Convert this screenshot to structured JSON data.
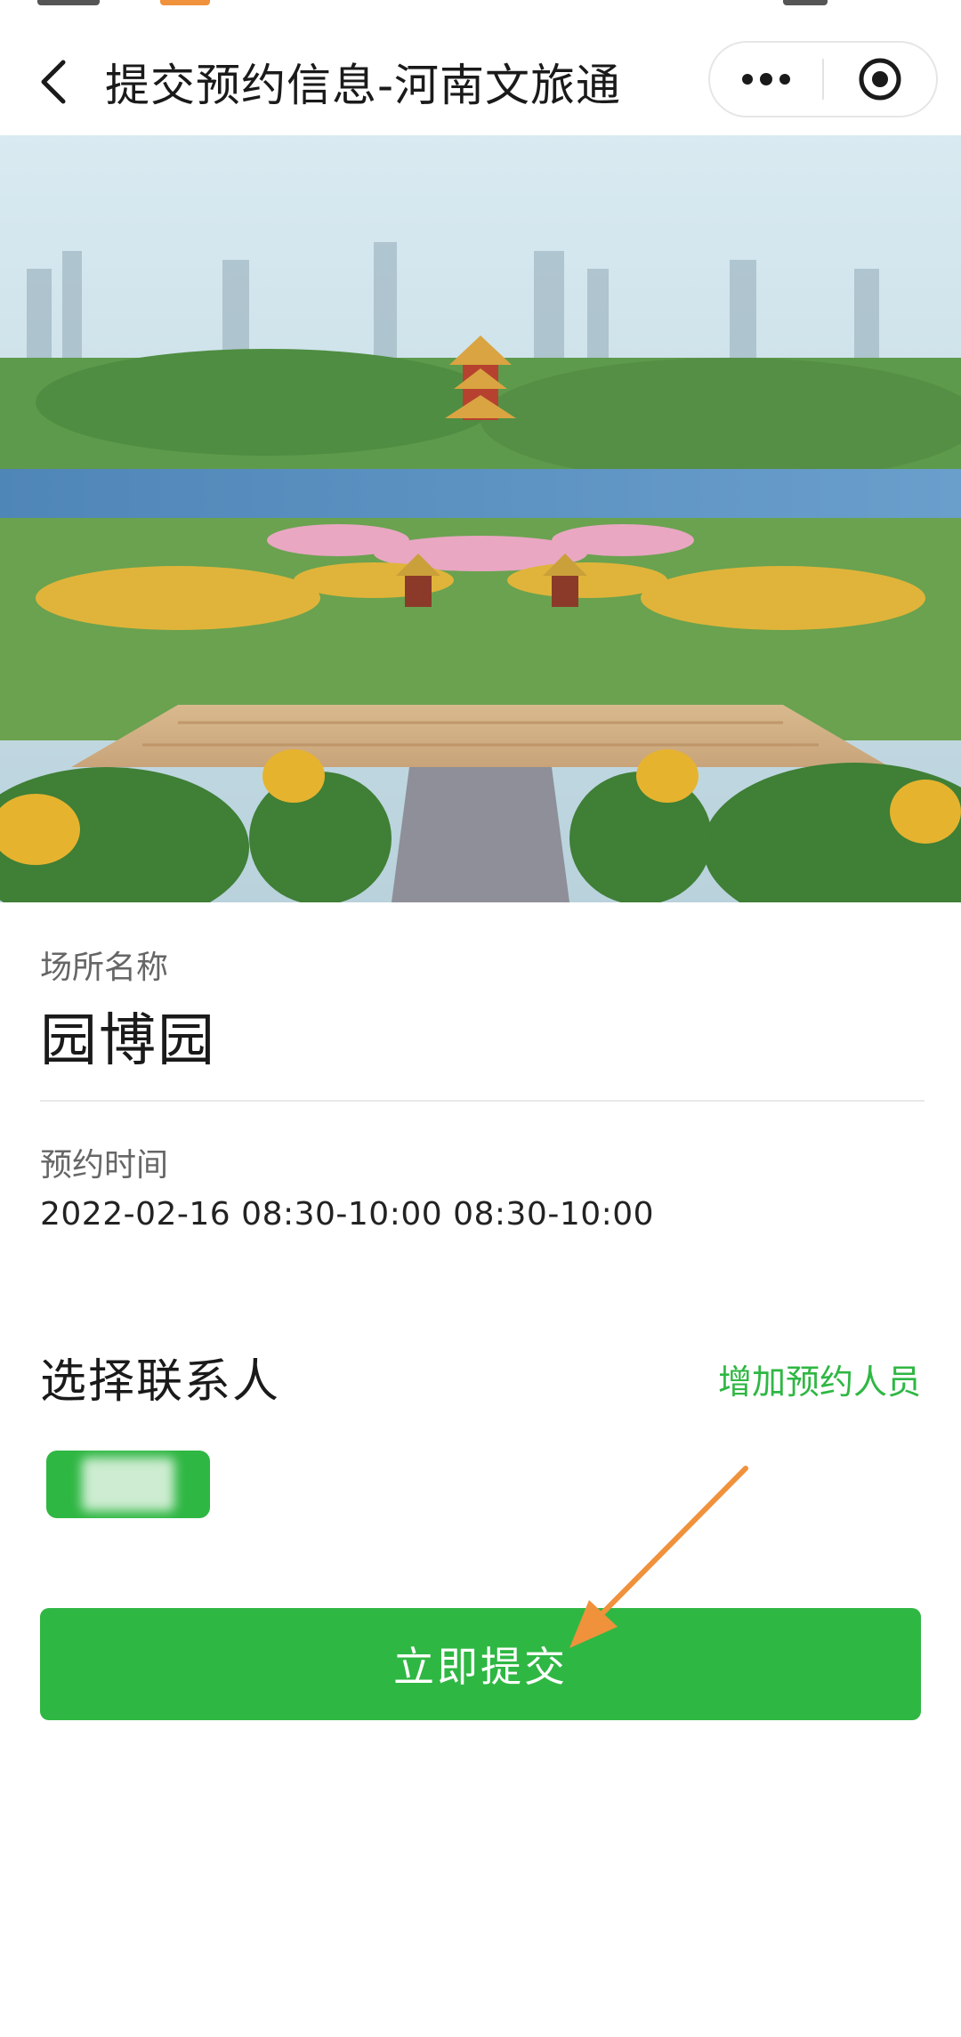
{
  "navbar": {
    "title": "提交预约信息-河南文旅通"
  },
  "venue": {
    "label": "场所名称",
    "name": "园博园"
  },
  "booking_time": {
    "label": "预约时间",
    "value": "2022-02-16 08:30-10:00 08:30-10:00"
  },
  "contacts": {
    "title": "选择联系人",
    "add_label": "增加预约人员"
  },
  "submit": {
    "label": "立即提交"
  },
  "colors": {
    "accent": "#2fb743",
    "annotation": "#f0913c"
  },
  "icons": [
    "chevron-left-icon",
    "more-dots-icon",
    "target-circle-icon"
  ]
}
